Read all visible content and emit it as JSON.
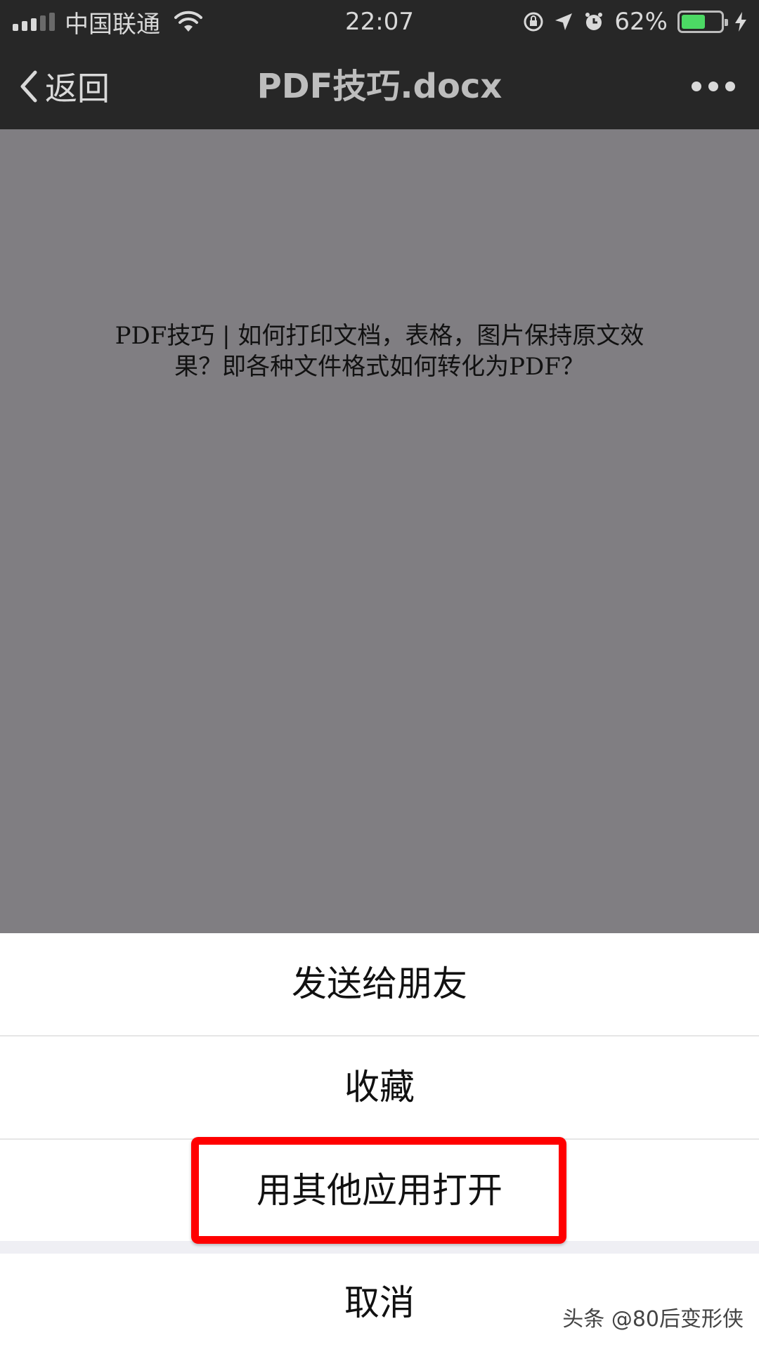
{
  "status_bar": {
    "carrier": "中国联通",
    "time": "22:07",
    "battery_percent": "62%",
    "battery_level": 0.62,
    "icons": [
      "signal-icon",
      "wifi-icon",
      "rotation-lock-icon",
      "location-icon",
      "alarm-icon",
      "battery-icon",
      "charging-icon"
    ]
  },
  "nav": {
    "back_label": "返回",
    "title": "PDF技巧.docx",
    "more_icon": "more-dots-icon"
  },
  "document": {
    "line1": "PDF技巧 | 如何打印文档，表格，图片保持原文效",
    "line2": "果？即各种文件格式如何转化为PDF？"
  },
  "action_sheet": {
    "items": [
      {
        "label": "发送给朋友"
      },
      {
        "label": "收藏"
      },
      {
        "label": "用其他应用打开",
        "highlighted": true
      }
    ],
    "cancel_label": "取消",
    "highlight_color": "#ff0000"
  },
  "watermark": "头条 @80后变形侠",
  "colors": {
    "bar_background": "#272727",
    "preview_background": "#807e82",
    "battery_green": "#4cd964"
  }
}
